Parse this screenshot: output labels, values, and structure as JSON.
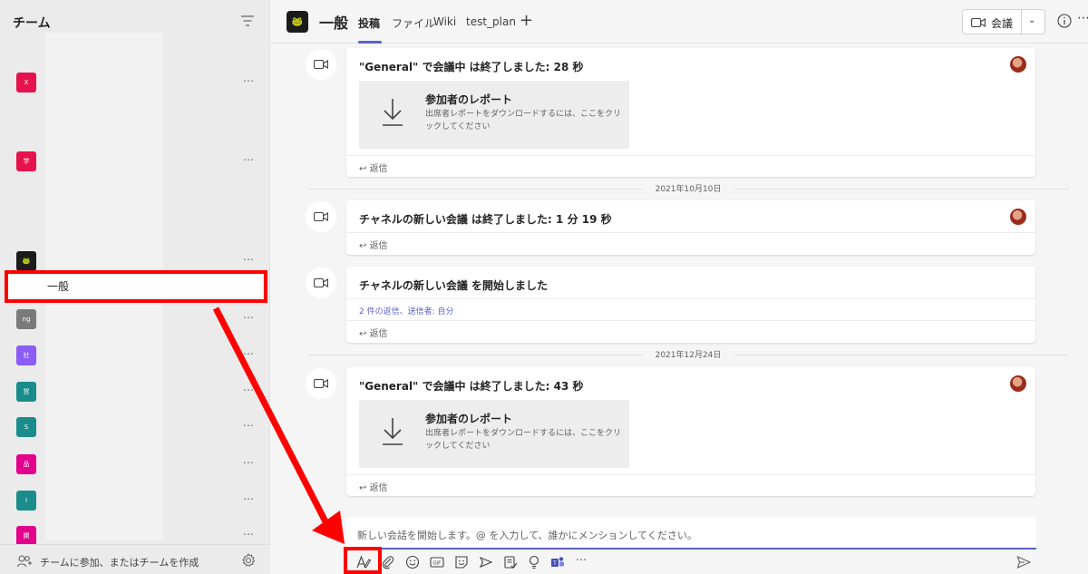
{
  "left_panel": {
    "header": "チーム",
    "teams": [
      {
        "initial": "X",
        "color": "#e5134d"
      },
      {
        "initial": "学",
        "color": "#e5134d"
      },
      {
        "initial": "🐸",
        "color": "#1b1b1b"
      },
      {
        "initial": "ng",
        "color": "#7a7a7a"
      },
      {
        "initial": "社",
        "color": "#8b5cf6"
      },
      {
        "initial": "営",
        "color": "#1a8c8c"
      },
      {
        "initial": "S",
        "color": "#1a8c8c"
      },
      {
        "initial": "品",
        "color": "#e3008c"
      },
      {
        "initial": "I",
        "color": "#1a8c8c"
      },
      {
        "initial": "開",
        "color": "#e3008c"
      }
    ],
    "selected_channel": "一般",
    "footer_text": "チームに参加、またはチームを作成"
  },
  "header": {
    "channel_name": "一般",
    "tabs": [
      "投稿",
      "ファイル",
      "Wiki",
      "test_plan"
    ],
    "meet_label": "会議"
  },
  "feed": {
    "reply_label": "返信",
    "report_title": "参加者のレポート",
    "report_desc": "出席者レポートをダウンロードするには、ここをクリックしてください",
    "posts": [
      {
        "title": "\"General\" で会議中 は終了しました: 28 秒"
      },
      {
        "title": "チャネルの新しい会議 は終了しました: 1 分 19 秒"
      },
      {
        "title": "チャネルの新しい会議 を開始しました",
        "replies_link": "2 件の返信、送信者: 自分"
      },
      {
        "title": "\"General\" で会議中 は終了しました: 43 秒"
      }
    ],
    "dates": [
      "2021年10月10日",
      "2021年12月24日"
    ]
  },
  "compose": {
    "placeholder": "新しい会話を開始します。@ を入力して、誰かにメンションしてください。"
  },
  "colors": {
    "accent": "#5b5fc7",
    "highlight": "#ff0000"
  }
}
